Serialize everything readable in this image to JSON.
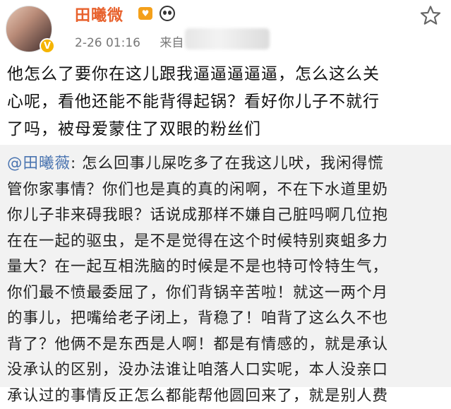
{
  "header": {
    "username": "田曦微",
    "timestamp": "2-26 01:16",
    "source_prefix": "来自",
    "verified_badge": "V",
    "heart_badge": "♥",
    "icons": [
      "avatar",
      "verified-badge",
      "heart-badge",
      "panda-badge",
      "star-icon"
    ]
  },
  "post": {
    "lines": [
      "他怎么了要你在这儿跟我逼逼逼逼逼，怎么这么关",
      "心呢，看他还能不能背得起锅？看好你儿子不就行",
      "了吗，被母爱蒙住了双眼的粉丝们"
    ]
  },
  "repost": {
    "mention": "@田曦薇",
    "first_line_rest": ": 怎么回事儿屎吃多了在我这儿吠，我闲得慌",
    "lines": [
      "管你家事情？你们也是真的真的闲啊，不在下水道里奶",
      "你儿子非来碍我眼？话说成那样不嫌自己脏吗啊几位抱",
      "在在一起的驱虫，是不是觉得在这个时候特别爽蛆多力",
      "量大？在一起互相洗脑的时候是不是也特可怜特生气，",
      "你们最不愤最委屈了，你们背锅辛苦啦！就这一两个月",
      "的事儿，把嘴给老子闭上，背稳了！咱背了这么久不也",
      "背了？他俩不是东西是人啊！都是有情感的，就是承认",
      "没承认的区别，没办法谁让咱落人口实呢，本人没亲口",
      "承认过的事情反正怎么都能帮他圆回来了，就是别人费"
    ]
  },
  "colors": {
    "username": "#e8612c",
    "mention": "#4a74b0",
    "repost_bg": "#f2f2f2",
    "meta": "#777777"
  }
}
